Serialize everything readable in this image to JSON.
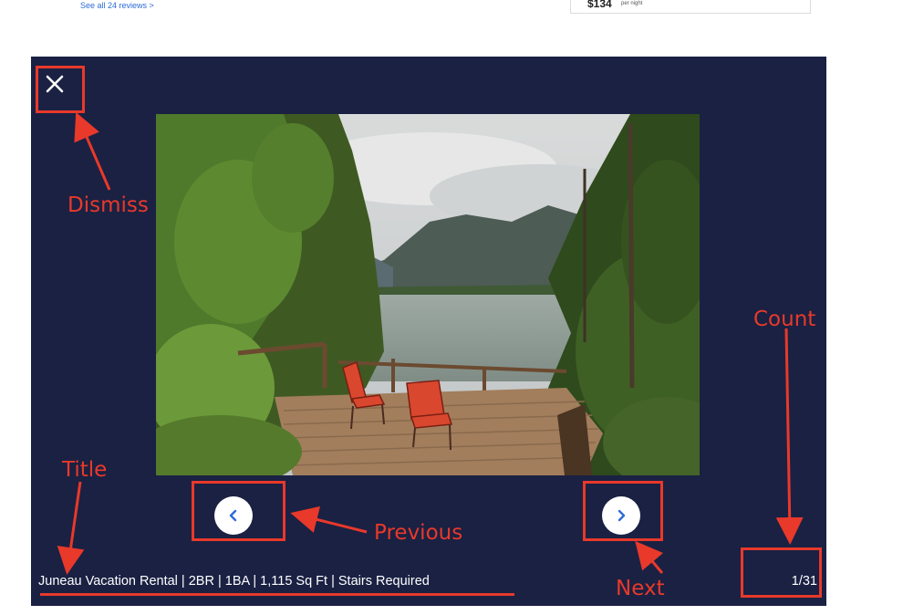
{
  "background_page": {
    "reviews_link": "See all 24 reviews  >",
    "price": "$134",
    "price_unit": "per night"
  },
  "gallery": {
    "title": "Juneau Vacation Rental | 2BR | 1BA | 1,115 Sq Ft | Stairs Required",
    "count": "1/31",
    "close_icon": "close-icon",
    "prev_icon": "chevron-left-icon",
    "next_icon": "chevron-right-icon",
    "photo_subject": "lakeside deck with two red chairs among evergreen trees and mountains"
  },
  "annotations": {
    "dismiss": "Dismiss",
    "count": "Count",
    "title": "Title",
    "previous": "Previous",
    "next": "Next"
  },
  "colors": {
    "modal_bg": "#1a2143",
    "annotation": "#e8392a",
    "link": "#2d6bd8"
  }
}
